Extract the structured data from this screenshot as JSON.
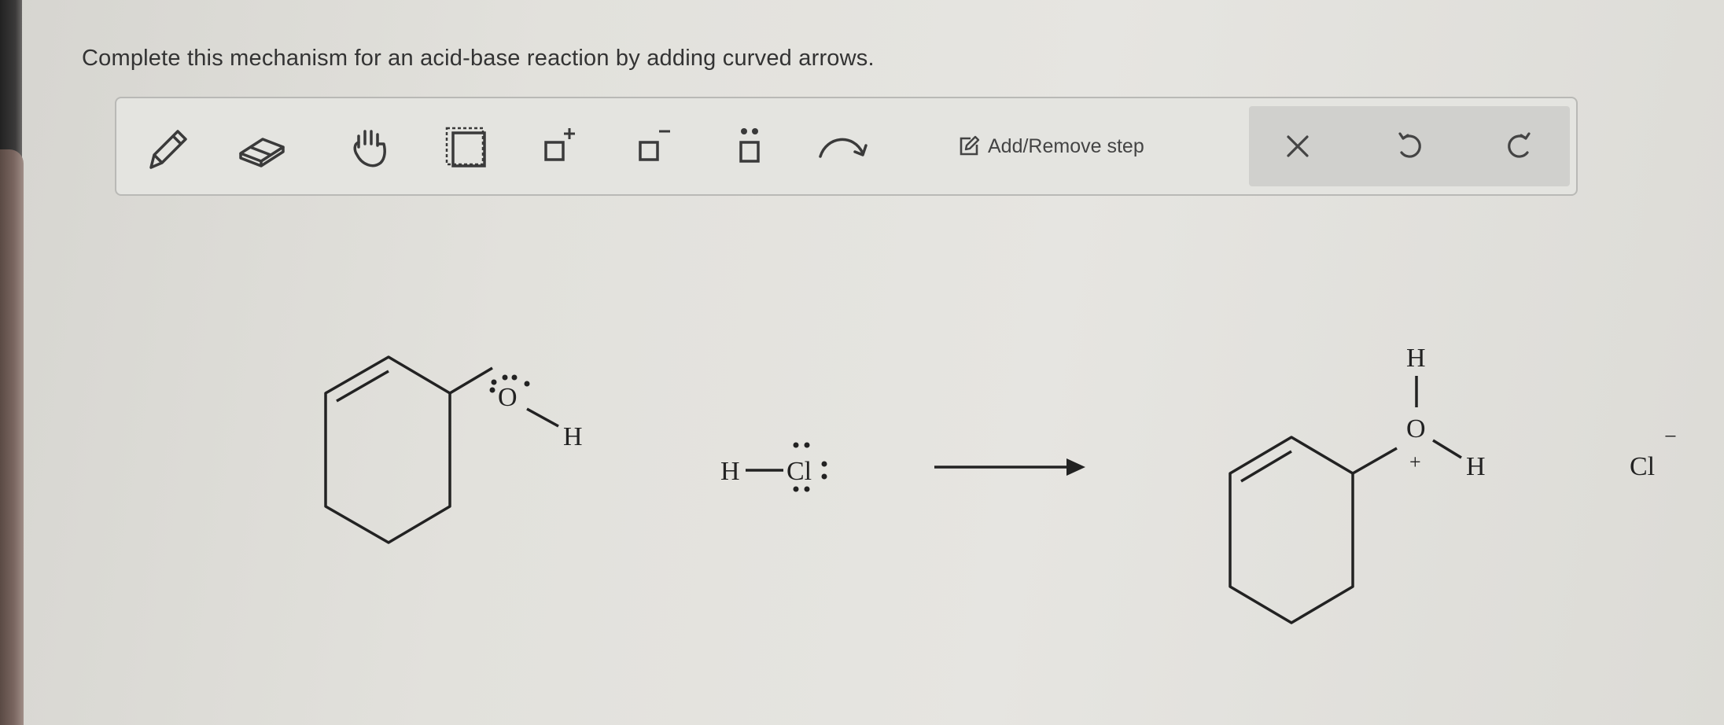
{
  "instructions": "Complete this mechanism for an acid-base reaction by adding curved arrows.",
  "toolbar": {
    "tools": [
      {
        "name": "pencil-icon"
      },
      {
        "name": "eraser-icon"
      },
      {
        "name": "hand-icon"
      },
      {
        "name": "selection-box-icon"
      },
      {
        "name": "positive-charge-icon",
        "symbol": "+"
      },
      {
        "name": "negative-charge-icon",
        "symbol": "−"
      },
      {
        "name": "lone-pair-icon"
      },
      {
        "name": "curved-arrow-icon"
      }
    ],
    "add_remove_step_label": "Add/Remove step",
    "actions": [
      {
        "name": "clear-icon"
      },
      {
        "name": "undo-icon"
      },
      {
        "name": "redo-icon"
      }
    ]
  },
  "molecules": {
    "reactant1": {
      "oxygen": "O",
      "hydrogen": "H"
    },
    "reactant2": {
      "hydrogen": "H",
      "chlorine": "Cl"
    },
    "product1": {
      "oxygen": "O",
      "hydrogen_top": "H",
      "hydrogen_right": "H",
      "charge": "+"
    },
    "product2": {
      "chlorine": "Cl",
      "charge": "−"
    }
  },
  "colors": {
    "ink": "#222222",
    "toolbar_icon": "#3a3a3a",
    "panel_bg": "#d0d0cd"
  }
}
